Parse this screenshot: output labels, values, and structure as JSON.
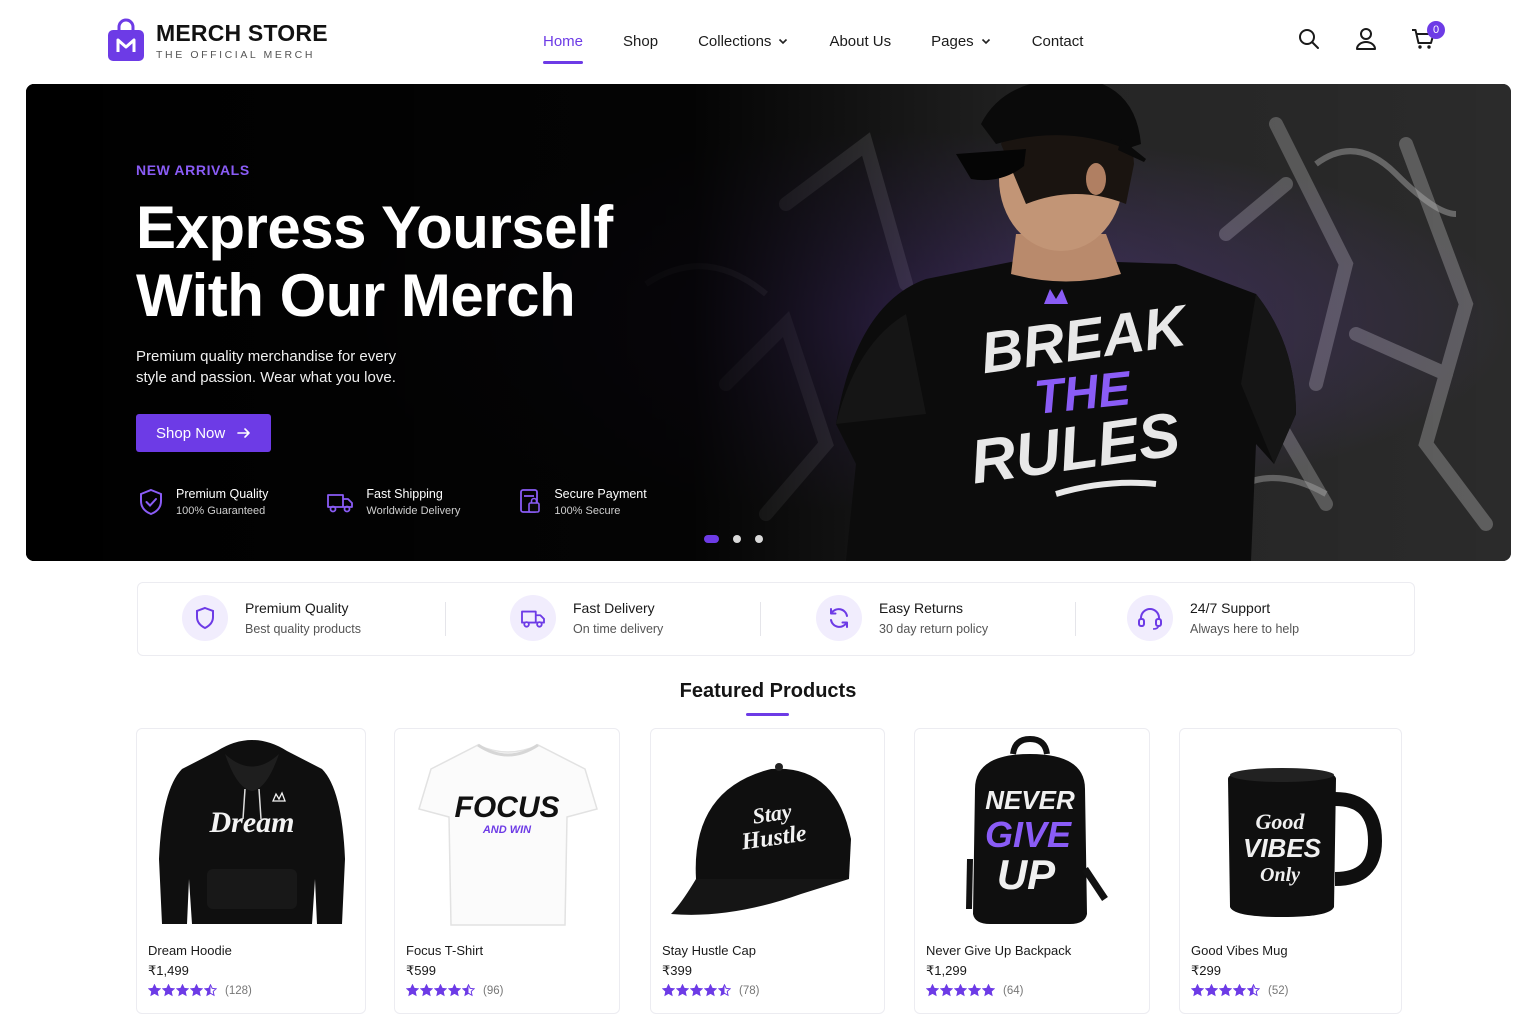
{
  "brand": {
    "title": "MERCH STORE",
    "subtitle": "THE OFFICIAL MERCH",
    "accent": "#6d3be6"
  },
  "nav": {
    "items": [
      {
        "label": "Home",
        "active": true
      },
      {
        "label": "Shop"
      },
      {
        "label": "Collections",
        "dropdown": true
      },
      {
        "label": "About Us"
      },
      {
        "label": "Pages",
        "dropdown": true
      },
      {
        "label": "Contact"
      }
    ]
  },
  "header_icons": {
    "search": "search-icon",
    "account": "user-icon",
    "cart": "cart-icon",
    "cart_count": "0"
  },
  "hero": {
    "eyebrow": "NEW ARRIVALS",
    "title_line1": "Express Yourself",
    "title_line2": "With Our Merch",
    "description": "Premium quality merchandise for every style and passion. Wear what you love.",
    "cta": "Shop Now",
    "shirt_text": [
      "BREAK",
      "THE",
      "RULES"
    ],
    "features": [
      {
        "title": "Premium Quality",
        "sub": "100% Guaranteed",
        "icon": "shield-check-icon"
      },
      {
        "title": "Fast Shipping",
        "sub": "Worldwide Delivery",
        "icon": "truck-icon"
      },
      {
        "title": "Secure Payment",
        "sub": "100% Secure",
        "icon": "secure-payment-icon"
      }
    ],
    "slides": 3,
    "active_slide": 1
  },
  "strip": [
    {
      "title": "Premium Quality",
      "sub": "Best quality products",
      "icon": "shield-icon"
    },
    {
      "title": "Fast Delivery",
      "sub": "On time delivery",
      "icon": "truck-icon"
    },
    {
      "title": "Easy Returns",
      "sub": "30 day return policy",
      "icon": "refresh-icon"
    },
    {
      "title": "24/7 Support",
      "sub": "Always here to help",
      "icon": "headset-icon"
    }
  ],
  "featured": {
    "title": "Featured Products",
    "products": [
      {
        "name": "Dream Hoodie",
        "price": "₹1,499",
        "count": "(128)",
        "rating": 4.5,
        "print": "Dream",
        "type": "hoodie"
      },
      {
        "name": "Focus T-Shirt",
        "price": "₹599",
        "count": "(96)",
        "rating": 4.5,
        "print": "FOCUS",
        "print2": "AND WIN",
        "type": "tshirt"
      },
      {
        "name": "Stay Hustle Cap",
        "price": "₹399",
        "count": "(78)",
        "rating": 4.5,
        "print": "Stay",
        "print2": "Hustle",
        "type": "cap"
      },
      {
        "name": "Never Give Up Backpack",
        "price": "₹1,299",
        "count": "(64)",
        "rating": 5,
        "print": "NEVER",
        "print2": "GIVE",
        "print3": "UP",
        "type": "backpack"
      },
      {
        "name": "Good Vibes Mug",
        "price": "₹299",
        "count": "(52)",
        "rating": 4.5,
        "print": "Good",
        "print2": "VIBES",
        "print3": "Only",
        "type": "mug"
      }
    ]
  }
}
